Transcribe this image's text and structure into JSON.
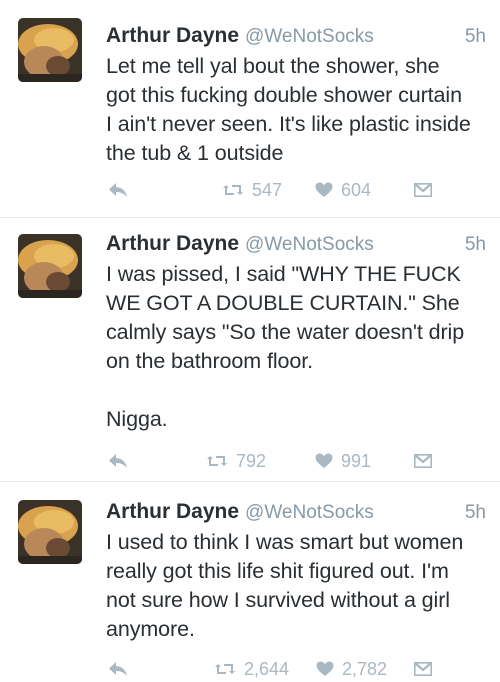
{
  "tweets": [
    {
      "name": "Arthur Dayne",
      "handle": "@WeNotSocks",
      "time": "5h",
      "text": "Let me tell yal bout the shower, she\ngot this fucking double shower curtain\nI ain't never seen. It's like plastic inside\nthe tub & 1 outside",
      "retweets": "547",
      "likes": "604"
    },
    {
      "name": "Arthur Dayne",
      "handle": "@WeNotSocks",
      "time": "5h",
      "text": "I was pissed, I said \"WHY THE FUCK\nWE GOT A DOUBLE CURTAIN.\" She\ncalmly says \"So the water doesn't drip\non the bathroom floor.\n\nNigga.",
      "retweets": "792",
      "likes": "991"
    },
    {
      "name": "Arthur Dayne",
      "handle": "@WeNotSocks",
      "time": "5h",
      "text": "I used to think I was smart but women\nreally got this life shit figured out. I'm\nnot sure how I survived without a girl\nanymore.",
      "retweets": "2,644",
      "likes": "2,782"
    }
  ],
  "icons": {
    "reply": "reply-icon",
    "retweet": "retweet-icon",
    "like": "heart-icon",
    "dm": "direct-message-icon",
    "avatar": "avatar"
  },
  "colors": {
    "icon_gray": "#aab8c2",
    "meta_gray": "#8899a6",
    "text": "#292f33",
    "divider": "#e1e8ed"
  }
}
